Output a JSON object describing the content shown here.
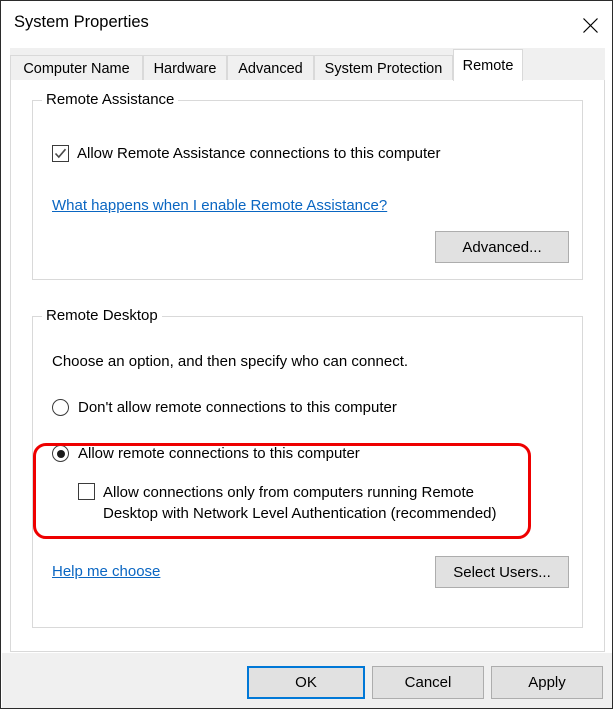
{
  "window": {
    "title": "System Properties",
    "close_icon": "close-icon"
  },
  "tabs": [
    {
      "label": "Computer Name",
      "active": false
    },
    {
      "label": "Hardware",
      "active": false
    },
    {
      "label": "Advanced",
      "active": false
    },
    {
      "label": "System Protection",
      "active": false
    },
    {
      "label": "Remote",
      "active": true
    }
  ],
  "remote_assistance": {
    "group_title": "Remote Assistance",
    "allow_checkbox": {
      "label": "Allow Remote Assistance connections to this computer",
      "checked": true
    },
    "help_link": "What happens when I enable Remote Assistance?",
    "advanced_button": "Advanced..."
  },
  "remote_desktop": {
    "group_title": "Remote Desktop",
    "description": "Choose an option, and then specify who can connect.",
    "options": [
      {
        "label": "Don't allow remote connections to this computer",
        "selected": false
      },
      {
        "label": "Allow remote connections to this computer",
        "selected": true
      }
    ],
    "nla_checkbox": {
      "label": "Allow connections only from computers running Remote Desktop with Network Level Authentication (recommended)",
      "checked": false
    },
    "help_link": "Help me choose",
    "select_users_button": "Select Users..."
  },
  "footer": {
    "ok_button": "OK",
    "cancel_button": "Cancel",
    "apply_button": "Apply"
  },
  "colors": {
    "accent": "#0078d7",
    "link": "#0a66c2",
    "highlight": "#ee0000",
    "button_face": "#e1e1e1",
    "dialog_face": "#f0f0f0"
  }
}
